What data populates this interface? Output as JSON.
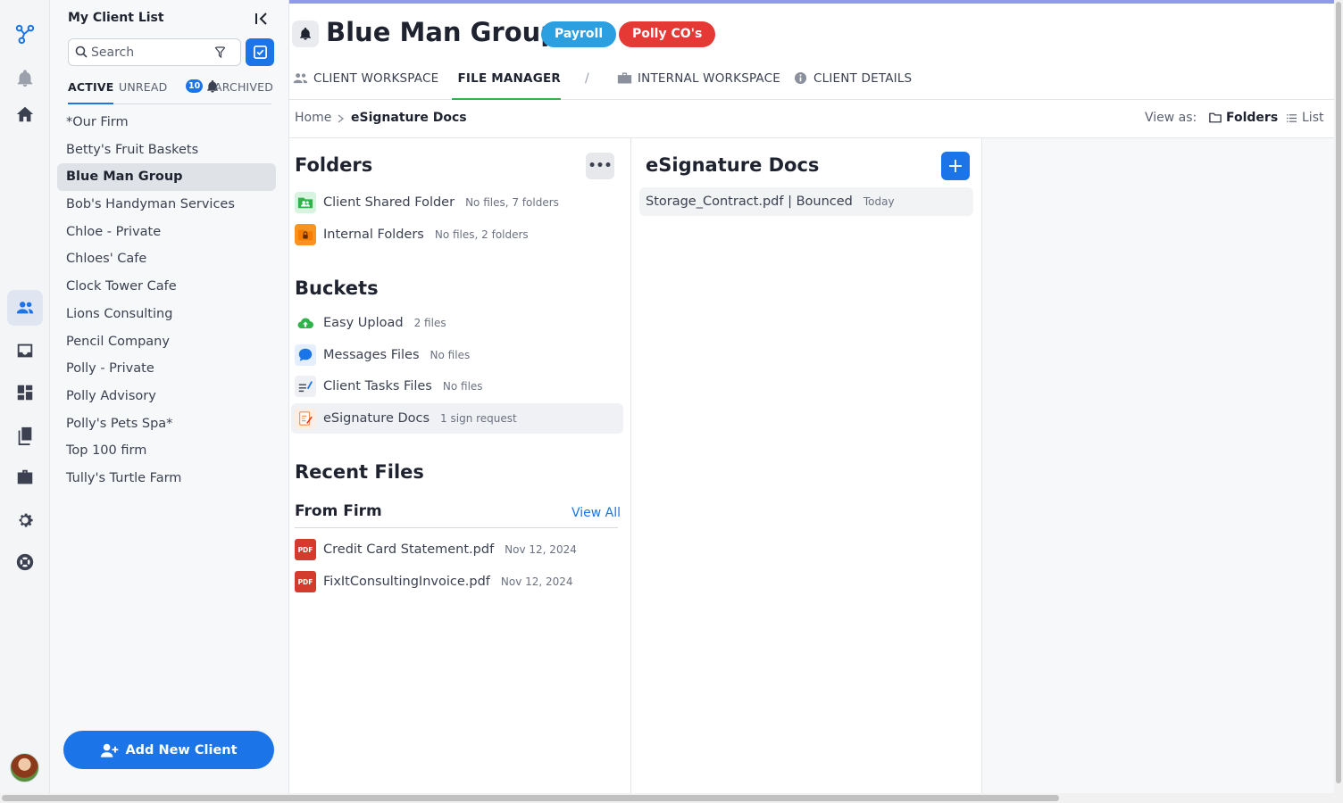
{
  "rail": {
    "items": [
      "logo-icon",
      "bell-icon",
      "home-icon",
      "clients-icon",
      "inbox-icon",
      "dashboard-icon",
      "documents-icon",
      "briefcase-icon",
      "settings-icon",
      "support-icon"
    ],
    "active": "clients-icon"
  },
  "client_panel": {
    "title": "My Client List",
    "search_placeholder": "Search",
    "tabs": {
      "active": "ACTIVE",
      "unread": "UNREAD",
      "unread_count": "10",
      "archived": "ARCHIVED"
    },
    "clients": [
      "*Our Firm",
      "Betty's Fruit Baskets",
      "Blue Man Group",
      "Bob's Handyman Services",
      "Chloe - Private",
      "Chloes' Cafe",
      "Clock Tower Cafe",
      "Lions Consulting",
      "Pencil Company",
      "Polly - Private",
      "Polly Advisory",
      "Polly's Pets Spa*",
      "Top 100 firm",
      "Tully's Turtle Farm"
    ],
    "selected_index": 2,
    "add_button": "Add New Client"
  },
  "header": {
    "title": "Blue Man Group",
    "tags": [
      {
        "label": "Payroll",
        "color": "#2b9fe0"
      },
      {
        "label": "Polly CO's",
        "color": "#e53935"
      }
    ]
  },
  "tabs": {
    "client_workspace": "CLIENT WORKSPACE",
    "file_manager": "FILE MANAGER",
    "separator": "/",
    "internal_workspace": "INTERNAL WORKSPACE",
    "client_details": "CLIENT DETAILS"
  },
  "breadcrumb": {
    "home": "Home",
    "current": "eSignature Docs"
  },
  "view": {
    "label": "View as:",
    "folders": "Folders",
    "list": "List"
  },
  "folders": {
    "title": "Folders",
    "more": "•••",
    "items": [
      {
        "name": "Client Shared Folder",
        "meta": "No files, 7 folders"
      },
      {
        "name": "Internal Folders",
        "meta": "No files, 2 folders"
      }
    ]
  },
  "buckets": {
    "title": "Buckets",
    "items": [
      {
        "name": "Easy Upload",
        "meta": "2 files"
      },
      {
        "name": "Messages Files",
        "meta": "No files"
      },
      {
        "name": "Client Tasks Files",
        "meta": "No files"
      },
      {
        "name": "eSignature Docs",
        "meta": "1 sign request"
      }
    ]
  },
  "recent": {
    "title": "Recent Files",
    "subtitle": "From Firm",
    "view_all": "View All",
    "pdf_label": "PDF",
    "files": [
      {
        "name": "Credit Card Statement.pdf",
        "date": "Nov 12, 2024"
      },
      {
        "name": "FixItConsultingInvoice.pdf",
        "date": "Nov 12, 2024"
      }
    ]
  },
  "esignature": {
    "title": "eSignature Docs",
    "add": "+",
    "docs": [
      {
        "name": "Storage_Contract.pdf | Bounced",
        "date": "Today"
      }
    ]
  },
  "colors": {
    "accent": "#1b74e8",
    "top_line": "#8d9bea",
    "file_manager_underline": "#2fb34a"
  }
}
